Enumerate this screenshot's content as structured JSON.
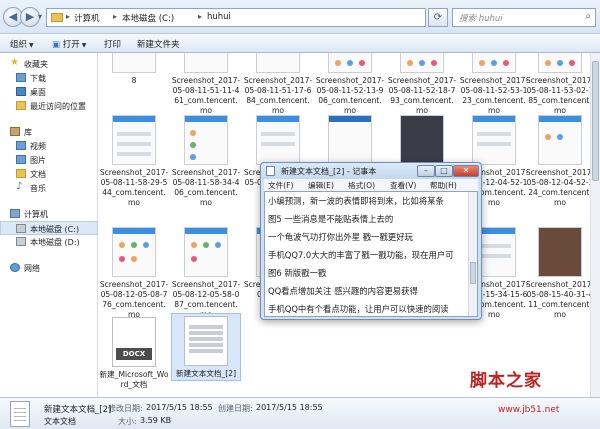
{
  "address_bar": {
    "path": [
      "计算机",
      "本地磁盘 (C:)",
      "huhui"
    ],
    "search_placeholder": "搜索 huhui"
  },
  "toolbar": {
    "organize": "组织",
    "open": "打开",
    "print": "打印",
    "new_folder": "新建文件夹"
  },
  "sidebar": {
    "favorites": "收藏夹",
    "downloads": "下载",
    "desktop": "桌面",
    "recent": "最近访问的位置",
    "libraries": "库",
    "videos": "视频",
    "pictures": "图片",
    "documents": "文档",
    "music": "音乐",
    "computer": "计算机",
    "local_c": "本地磁盘 (C:)",
    "local_d": "本地磁盘 (D:)",
    "network": "网络"
  },
  "files": [
    {
      "name": "8"
    },
    {
      "name": "Screenshot_2017-05-08-11-51-11-461_com.tencent.mo"
    },
    {
      "name": "Screenshot_2017-05-08-11-51-17-684_com.tencent.mo"
    },
    {
      "name": "Screenshot_2017-05-08-11-52-13-906_com.tencent.mo"
    },
    {
      "name": "Screenshot_2017-05-08-11-52-18-793_com.tencent.mo"
    },
    {
      "name": "Screenshot_2017-05-08-11-52-53-123_com.tencent.mo"
    },
    {
      "name": "Screenshot_2017-05-08-11-53-02-185_com.tencent.mo"
    },
    {
      "name": "Screenshot_2017-05-08-11-58-29-544_com.tencent.mo"
    },
    {
      "name": "Screenshot_2017-05-08-11-58-34-406_com.tencent.mo"
    },
    {
      "name": "Screenshot_2017-05-08-11-58-57-0"
    },
    {
      "name": "Screenshot_2017-05-08-12-04-52-124_com.tencent.mo"
    },
    {
      "name": "Screenshot_2017-05-08-12-04-52-324_com.tencent.mo"
    },
    {
      "name": "Screenshot_2017-05-08-12-05-08-776_com.tencent.mo"
    },
    {
      "name": "Screenshot_2017-05-08-12-05-58-087_com.tencent.mo"
    },
    {
      "name": "Screenshot_2017-05-08-12-0"
    },
    {
      "name": "Screenshot_2017-05-08-15-34-15-600_com.tencent.mo"
    },
    {
      "name": "Screenshot_2017-05-08-15-40-31-411_com.tencent.mo"
    },
    {
      "name": "新建_Microsoft_Word_文档"
    },
    {
      "name": "新建文本文档_[2]"
    }
  ],
  "doc_badge": "DOCX",
  "notepad": {
    "title": "新建文本文档_[2] - 记事本",
    "menu": [
      "文件(F)",
      "编辑(E)",
      "格式(O)",
      "查看(V)",
      "帮助(H)"
    ],
    "lines": [
      "小编预测，新一波的表情即将到来，比如将某条",
      "图5 一些消息是不能贴表情上去的",
      "一个龟波气功打你出外星 戳一戳更好玩",
      "手机QQ7.0大大的丰富了戳一戳功能，现在用户可",
      "图6 新版戳一戳",
      " QQ看点增加关注 感兴趣的内容更易获得",
      "手机QQ中有个看点功能，让用户可以快速的阅读"
    ]
  },
  "details": {
    "file_name": "新建文本文档_[2]",
    "file_type": "文本文档",
    "modified_label": "修改日期:",
    "modified_value": "2017/5/15 18:55",
    "created_label": "创建日期:",
    "created_value": "2017/5/15 18:55",
    "size_label": "大小:",
    "size_value": "3.59 KB"
  },
  "watermark": {
    "brand": "脚本之家",
    "url": "www.jb51.net"
  }
}
